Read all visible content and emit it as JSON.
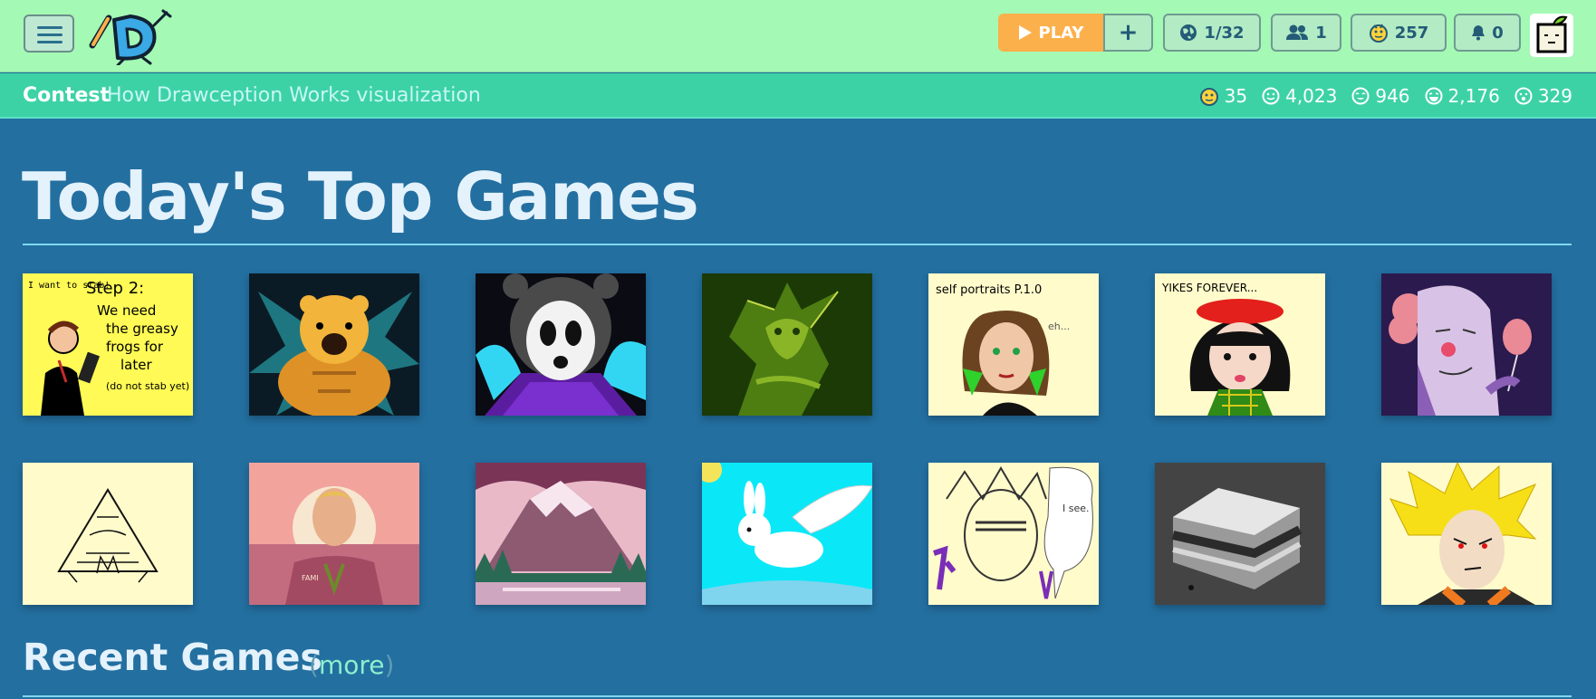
{
  "header": {
    "play_label": "PLAY",
    "plus_label": "+",
    "games_count": "1/32",
    "friends_count": "1",
    "coins_count": "257",
    "notifications_count": "0"
  },
  "contest_bar": {
    "label": "Contest",
    "title": "How Drawception Works visualization",
    "stats": [
      "35",
      "4,023",
      "946",
      "2,176",
      "329"
    ]
  },
  "top_games": {
    "title": "Today's Top Games",
    "captions": {
      "step2": [
        "I want to stab!",
        "Step 2:",
        "We need",
        "the greasy",
        "frogs for",
        "later",
        "(do not stab yet)"
      ],
      "self_portraits": [
        "self portraits P.1.0",
        "eh..."
      ],
      "yikes": "YIKES  FOREVER...",
      "fami": "FAMI",
      "i_see": "I see."
    }
  },
  "recent_games": {
    "title": "Recent Games",
    "more_open": "(",
    "more_label": "more",
    "more_close": ")"
  }
}
